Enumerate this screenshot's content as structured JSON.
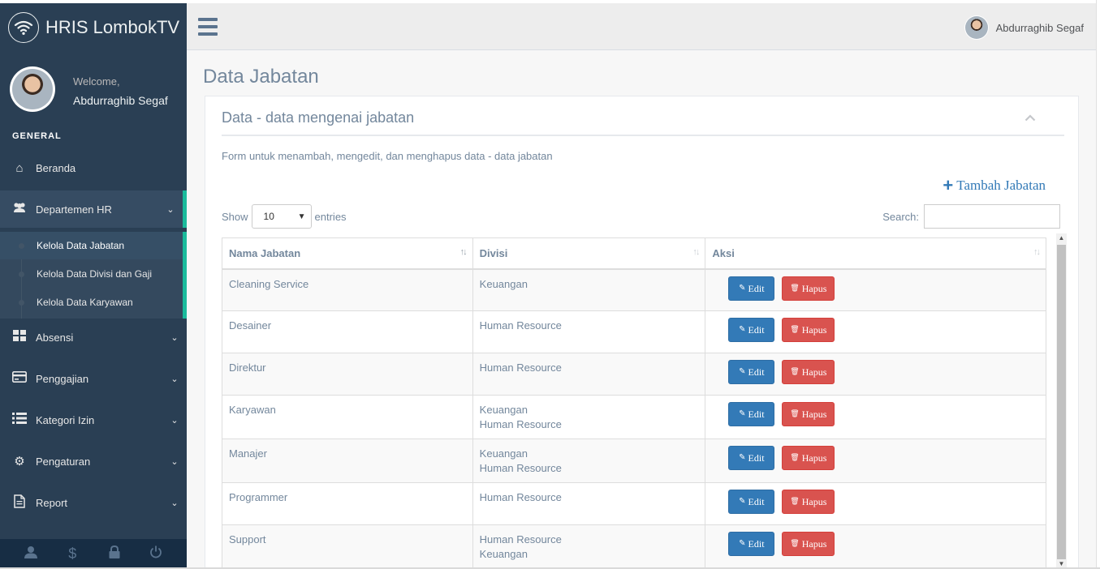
{
  "app": {
    "brand": "HRIS LombokTV"
  },
  "profile": {
    "welcome": "Welcome,",
    "name": "Abdurraghib Segaf"
  },
  "sidebar": {
    "section": "GENERAL",
    "items": [
      {
        "label": "Beranda",
        "icon": "home-icon"
      },
      {
        "label": "Departemen HR",
        "icon": "users-icon"
      },
      {
        "label": "Absensi",
        "icon": "grid-icon"
      },
      {
        "label": "Penggajian",
        "icon": "credit-card-icon"
      },
      {
        "label": "Kategori Izin",
        "icon": "list-icon"
      },
      {
        "label": "Pengaturan",
        "icon": "gear-icon"
      },
      {
        "label": "Report",
        "icon": "file-icon"
      }
    ],
    "submenu": [
      {
        "label": "Kelola Data Jabatan"
      },
      {
        "label": "Kelola Data Divisi dan Gaji"
      },
      {
        "label": "Kelola Data Karyawan"
      }
    ],
    "footer_icons": [
      "user-icon",
      "dollar-icon",
      "lock-icon",
      "power-icon"
    ]
  },
  "topnav": {
    "user_name": "Abdurraghib Segaf"
  },
  "page": {
    "title": "Data Jabatan"
  },
  "panel": {
    "title": "Data - data mengenai jabatan",
    "description": "Form untuk menambah, mengedit, dan menghapus data - data jabatan",
    "add_label": "Tambah Jabatan",
    "show_label": "Show",
    "entries_value": "10",
    "entries_label": "entries",
    "search_label": "Search:",
    "search_value": ""
  },
  "table": {
    "headers": [
      "Nama Jabatan",
      "Divisi",
      "Aksi"
    ],
    "edit_label": "Edit",
    "delete_label": "Hapus",
    "rows": [
      {
        "name": "Cleaning Service",
        "div1": "Keuangan",
        "div2": ""
      },
      {
        "name": "Desainer",
        "div1": "Human Resource",
        "div2": ""
      },
      {
        "name": "Direktur",
        "div1": "Human Resource",
        "div2": ""
      },
      {
        "name": "Karyawan",
        "div1": "Keuangan",
        "div2": "Human Resource"
      },
      {
        "name": "Manajer",
        "div1": "Keuangan",
        "div2": "Human Resource"
      },
      {
        "name": "Programmer",
        "div1": "Human Resource",
        "div2": ""
      },
      {
        "name": "Support",
        "div1": "Human Resource",
        "div2": "Keuangan"
      }
    ]
  },
  "colors": {
    "sidebar": "#2A3F54",
    "accent": "#1ABB9C",
    "edit_button": "#337AB7",
    "delete_button": "#D9534F"
  }
}
